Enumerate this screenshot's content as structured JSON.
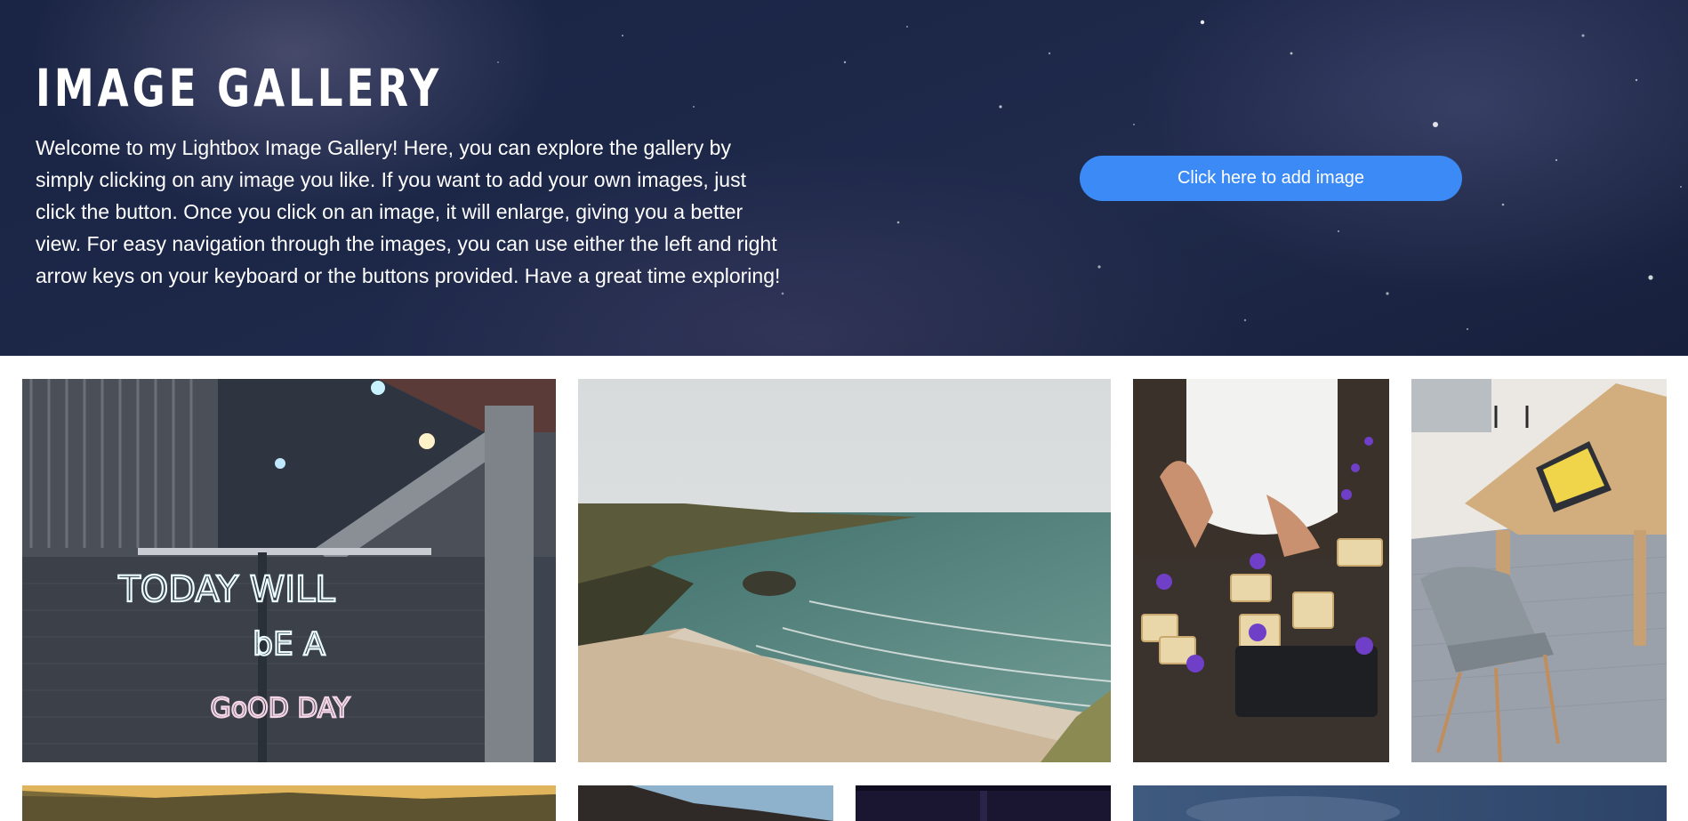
{
  "header": {
    "title": "IMAGE GALLERY",
    "intro": "Welcome to my Lightbox Image Gallery! Here, you can explore the gallery by simply clicking on any image you like. If you want to add your own images, just click the button. Once you click on an image, it will enlarge, giving you a better view. For easy navigation through the images, you can use either the left and right arrow keys on your keyboard or the buttons provided. Have a great time exploring!",
    "add_button_label": "Click here to add image"
  },
  "gallery": {
    "images": [
      {
        "subject": "neon sign on warehouse wall",
        "sign_lines": [
          "TODAY WILL",
          "bE A",
          "GoOD DAY"
        ]
      },
      {
        "subject": "coastal beach with waves"
      },
      {
        "subject": "hands decorating cookies with violets"
      },
      {
        "subject": "wooden table with tablet and chairs"
      },
      {
        "subject": "hillside at sunset"
      },
      {
        "subject": "cliff against blue sky"
      },
      {
        "subject": "dark night scene"
      },
      {
        "subject": "cloudy blue sky"
      }
    ]
  },
  "colors": {
    "hero_bg": "#1c2748",
    "button_bg": "#3b8af5",
    "page_bg": "#ffffff"
  }
}
